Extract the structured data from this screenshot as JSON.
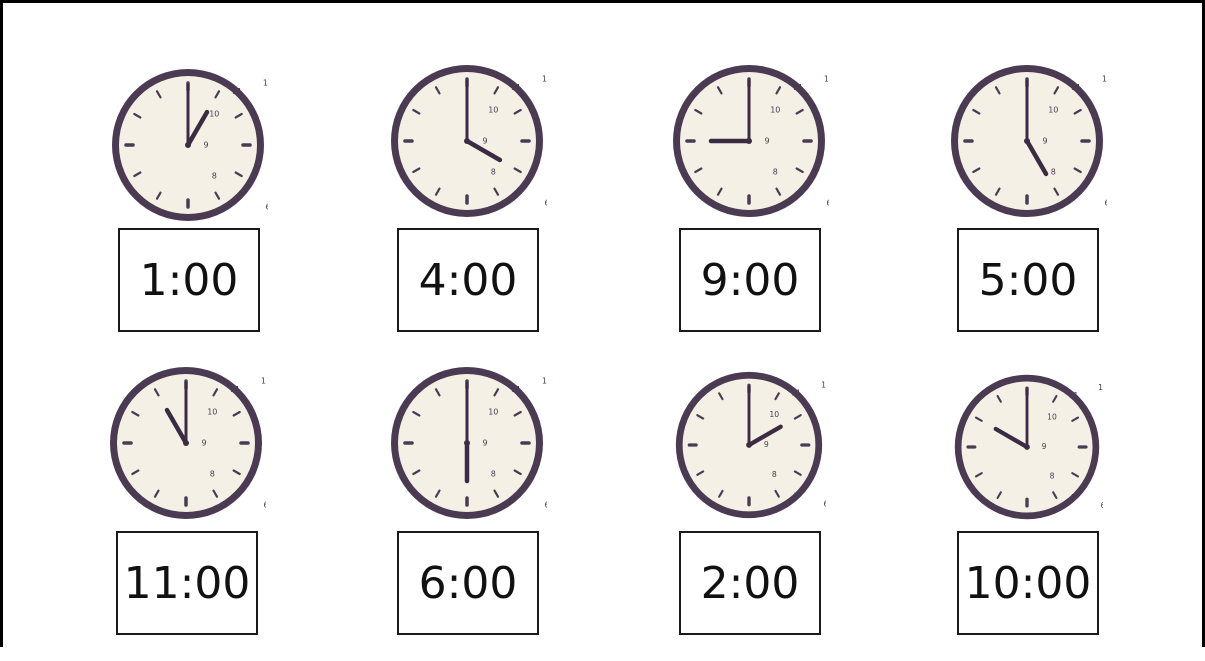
{
  "colors": {
    "rim": "#4a3a52",
    "face": "#f5f0e6",
    "hands": "#3b2c43",
    "ticks": "#4a3a52"
  },
  "clocks": [
    {
      "label": "1:00",
      "hour": 1,
      "minute": 0
    },
    {
      "label": "4:00",
      "hour": 4,
      "minute": 0
    },
    {
      "label": "9:00",
      "hour": 9,
      "minute": 0
    },
    {
      "label": "5:00",
      "hour": 5,
      "minute": 0
    },
    {
      "label": "11:00",
      "hour": 11,
      "minute": 0
    },
    {
      "label": "6:00",
      "hour": 6,
      "minute": 0
    },
    {
      "label": "2:00",
      "hour": 2,
      "minute": 0
    },
    {
      "label": "10:00",
      "hour": 10,
      "minute": 0
    }
  ]
}
